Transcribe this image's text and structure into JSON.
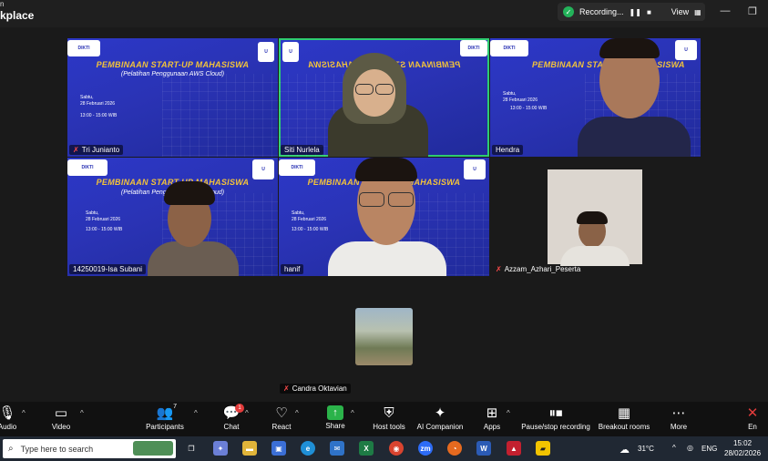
{
  "window": {
    "title_top": "n",
    "title": "kplace",
    "recording_label": "Recording...",
    "view_label": "View"
  },
  "tiles": [
    {
      "name": "Tri Junianto"
    },
    {
      "name": "Siti Nurlela"
    },
    {
      "name": "Hendra"
    },
    {
      "name": "14250019-Isa Subani"
    },
    {
      "name": "hanif"
    },
    {
      "name": "Azzam_Azhari_Peserta"
    },
    {
      "name": "Candra Oktavian"
    }
  ],
  "slide": {
    "title": "PEMBINAAN START-UP MAHASISWA",
    "subtitle": "(Pelatihan Penggunaan AWS Cloud)",
    "day": "Sabtu,",
    "date": "28 Februari 2026",
    "time": "13:00 - 15:00 WIB"
  },
  "toolbar": {
    "audio": "Audio",
    "video": "Video",
    "participants": "Participants",
    "participants_count": "7",
    "chat": "Chat",
    "chat_badge": "1",
    "react": "React",
    "share": "Share",
    "host_tools": "Host tools",
    "ai_companion": "AI Companion",
    "apps": "Apps",
    "pause_stop": "Pause/stop recording",
    "breakout": "Breakout rooms",
    "more": "More",
    "end": "En"
  },
  "taskbar": {
    "search_placeholder": "Type here to search",
    "weather": "31°C",
    "language": "ENG",
    "time": "15:02",
    "date": "28/02/2026",
    "zoom_badge": "zm",
    "excel": "X",
    "word": "W"
  },
  "colors": {
    "slide_blue": "#2a33b5",
    "slide_title": "#f3c33a",
    "active_speaker": "#2ecc71",
    "recording_shield": "#23b35a",
    "share_green": "#2bb34a"
  }
}
